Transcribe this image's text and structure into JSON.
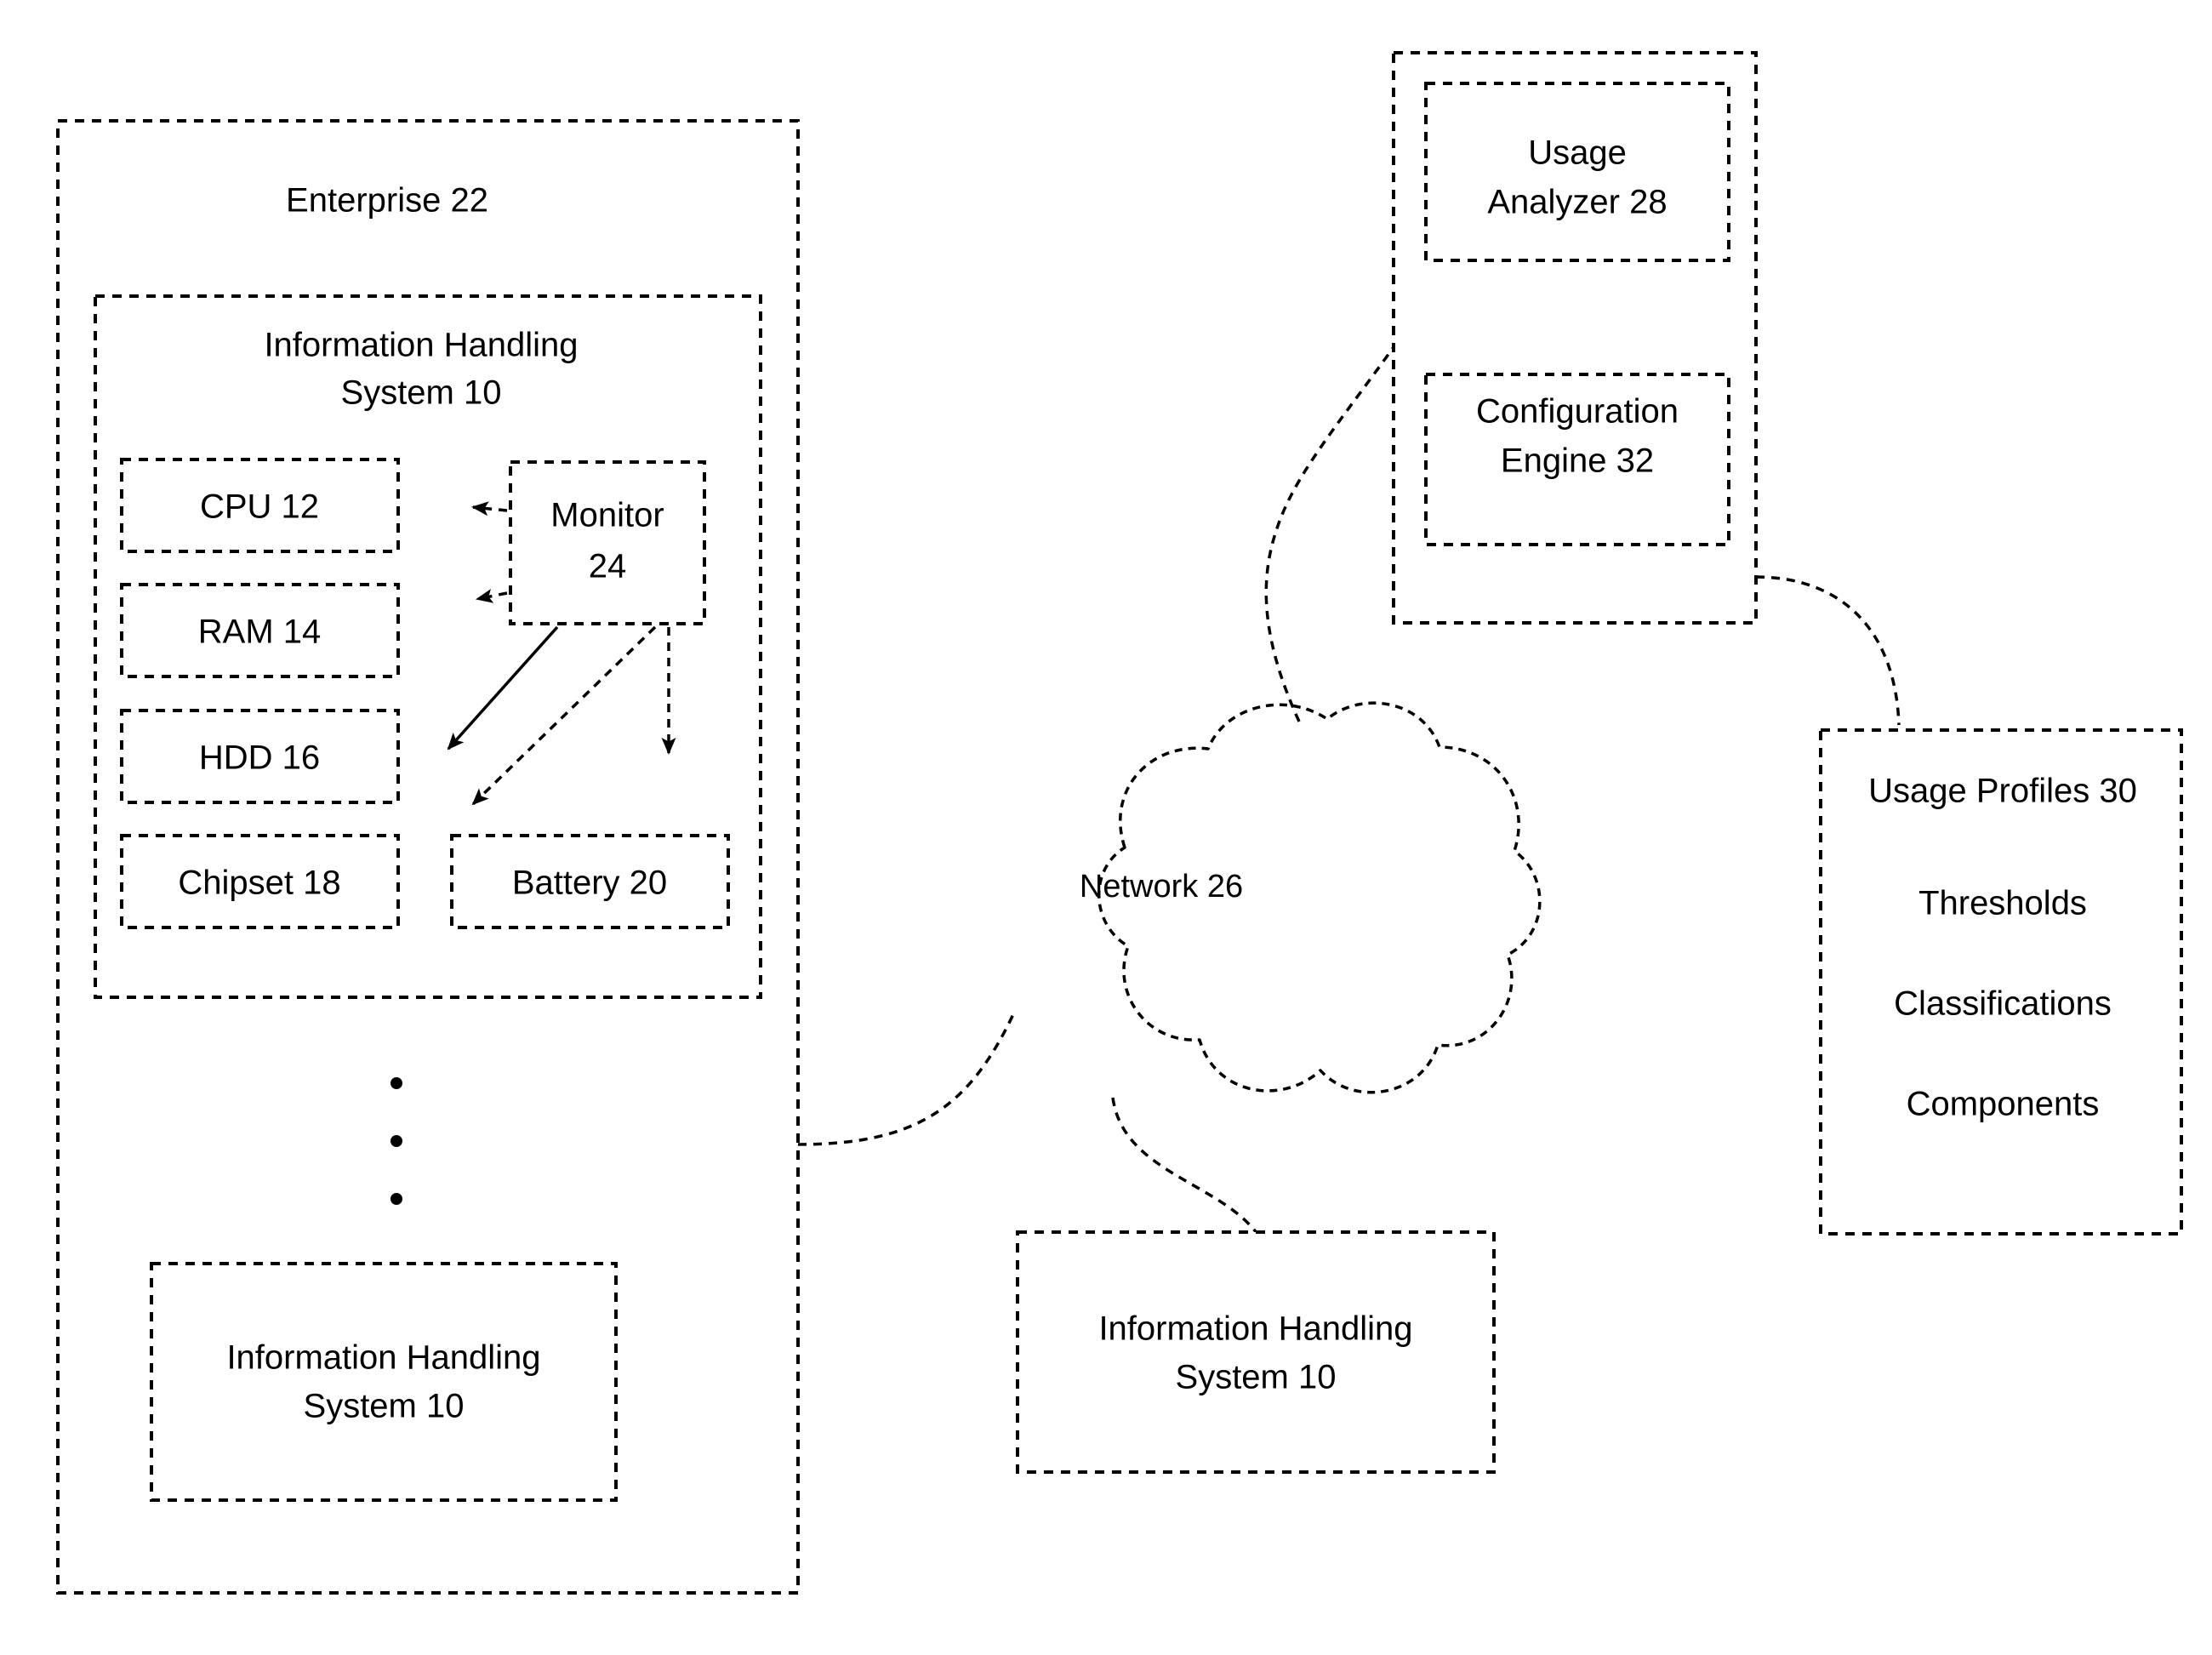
{
  "figure": {
    "type": "patent-block-diagram",
    "background_color": "#ffffff",
    "line_color": "#000000",
    "line_style": "dashed"
  },
  "enterprise": {
    "title": "Enterprise 22",
    "information_handling_system": {
      "title_line1": "Information Handling",
      "title_line2": "System 10",
      "components": [
        {
          "label": "CPU 12"
        },
        {
          "label": "RAM 14"
        },
        {
          "label": "HDD 16"
        },
        {
          "label": "Chipset 18"
        }
      ],
      "battery": {
        "label": "Battery 20"
      },
      "monitor": {
        "line1": "Monitor",
        "line2": "24"
      }
    },
    "ellipsis": "•••",
    "additional_system": {
      "title_line1": "Information Handling",
      "title_line2": "System 10"
    }
  },
  "network": {
    "label": "Network 26"
  },
  "remote_system": {
    "title_line1": "Information Handling",
    "title_line2": "System 10"
  },
  "analyzer_container": {
    "usage_analyzer": {
      "line1": "Usage",
      "line2": "Analyzer 28"
    },
    "configuration_engine": {
      "line1": "Configuration",
      "line2": "Engine 32"
    }
  },
  "usage_profiles": {
    "title": "Usage Profiles 30",
    "entries": [
      {
        "label": "Thresholds"
      },
      {
        "label": "Classifications"
      },
      {
        "label": "Components"
      }
    ]
  }
}
